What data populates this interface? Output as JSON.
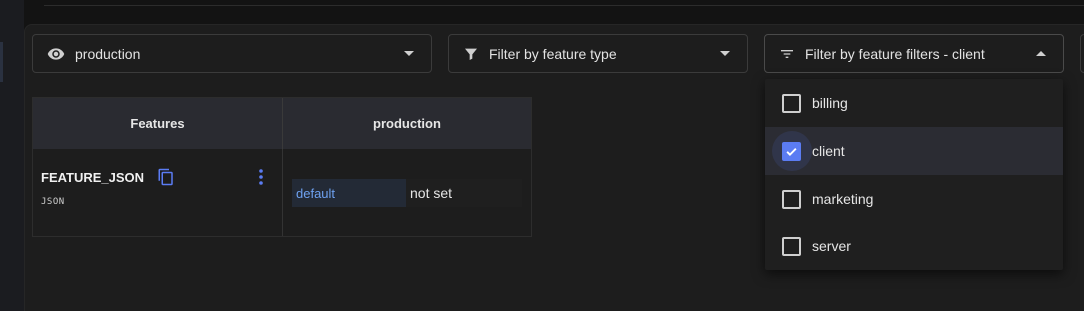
{
  "filters": {
    "environment": {
      "icon": "eye-icon",
      "value": "production"
    },
    "feature_type": {
      "icon": "funnel-icon",
      "placeholder": "Filter by feature type"
    },
    "feature_filters": {
      "icon": "filter-list-icon",
      "value": "Filter by feature filters - client"
    }
  },
  "table": {
    "headers": [
      "Features",
      "production"
    ],
    "rows": [
      {
        "name": "FEATURE_JSON",
        "type": "JSON",
        "value_input": "default",
        "value_text": "not set"
      }
    ]
  },
  "dropdown": {
    "options": [
      {
        "label": "billing",
        "checked": false
      },
      {
        "label": "client",
        "checked": true
      },
      {
        "label": "marketing",
        "checked": false
      },
      {
        "label": "server",
        "checked": false
      }
    ]
  },
  "colors": {
    "accent": "#5b7cf3",
    "link_value": "#6ea1f0",
    "background": "#1d1d1d"
  }
}
